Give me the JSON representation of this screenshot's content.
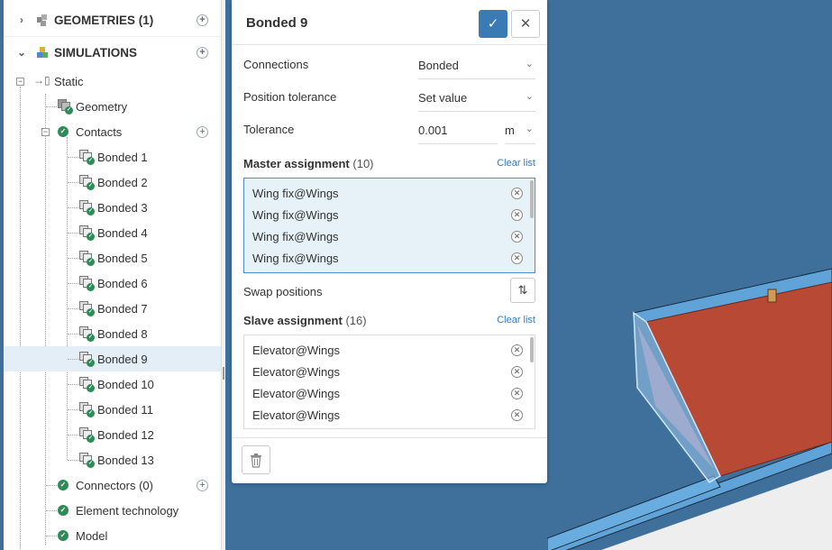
{
  "tree": {
    "geometries": {
      "label": "GEOMETRIES (1)"
    },
    "simulations": {
      "label": "SIMULATIONS"
    },
    "static": {
      "label": "Static"
    },
    "geometry": {
      "label": "Geometry"
    },
    "contacts": {
      "label": "Contacts"
    },
    "bonded": [
      {
        "label": "Bonded 1"
      },
      {
        "label": "Bonded 2"
      },
      {
        "label": "Bonded 3"
      },
      {
        "label": "Bonded 4"
      },
      {
        "label": "Bonded 5"
      },
      {
        "label": "Bonded 6"
      },
      {
        "label": "Bonded 7"
      },
      {
        "label": "Bonded 8"
      },
      {
        "label": "Bonded 9"
      },
      {
        "label": "Bonded 10"
      },
      {
        "label": "Bonded 11"
      },
      {
        "label": "Bonded 12"
      },
      {
        "label": "Bonded 13"
      }
    ],
    "connectors": {
      "label": "Connectors (0)"
    },
    "element_technology": {
      "label": "Element technology"
    },
    "model": {
      "label": "Model"
    }
  },
  "panel": {
    "title": "Bonded 9",
    "connections": {
      "label": "Connections",
      "value": "Bonded"
    },
    "position_tolerance": {
      "label": "Position tolerance",
      "value": "Set value"
    },
    "tolerance": {
      "label": "Tolerance",
      "value": "0.001",
      "unit": "m"
    },
    "master": {
      "title": "Master assignment",
      "count": "(10)",
      "clear": "Clear list",
      "items": [
        "Wing fix@Wings",
        "Wing fix@Wings",
        "Wing fix@Wings",
        "Wing fix@Wings"
      ]
    },
    "swap": {
      "label": "Swap positions"
    },
    "slave": {
      "title": "Slave assignment",
      "count": "(16)",
      "clear": "Clear list",
      "items": [
        "Elevator@Wings",
        "Elevator@Wings",
        "Elevator@Wings",
        "Elevator@Wings"
      ]
    }
  },
  "colors": {
    "accent": "#3a7bb5",
    "success": "#2e8b57",
    "viewport_bg": "#3f6f9b",
    "part_red": "#b84a35",
    "part_blue": "#5fa3d8"
  }
}
